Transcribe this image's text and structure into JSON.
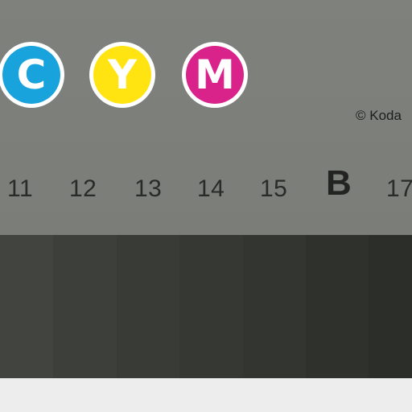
{
  "circles": [
    {
      "letter": "C",
      "color": "#19a3dc"
    },
    {
      "letter": "Y",
      "color": "#ffe411"
    },
    {
      "letter": "M",
      "color": "#d9238b"
    }
  ],
  "copyright": "© Koda",
  "step_numbers": [
    "11",
    "12",
    "13",
    "14",
    "15",
    "B",
    "17"
  ],
  "step_colors": [
    "#42453f",
    "#3d403a",
    "#393c36",
    "#363933",
    "#323530",
    "#2f322c",
    "#2b2e29"
  ]
}
